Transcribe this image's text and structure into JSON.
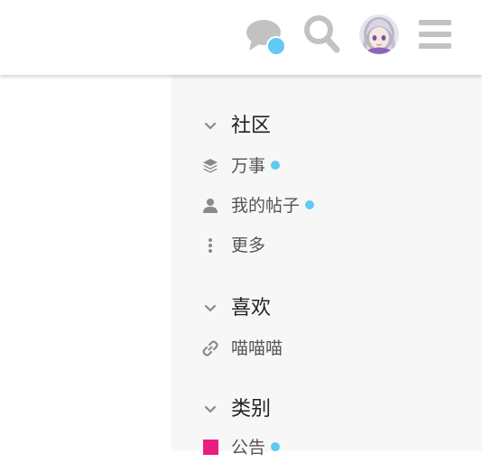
{
  "colors": {
    "accent_dot": "#62c8f5",
    "icon_gray": "#c2c2c2",
    "sidebar_icon": "#8a8a8a",
    "category_announcement": "#e91e80"
  },
  "header": {
    "chat_icon": "chat-bubbles-icon",
    "search_icon": "search-icon",
    "avatar_icon": "user-avatar",
    "menu_icon": "hamburger-menu-icon"
  },
  "sidebar": {
    "community": {
      "title": "社区",
      "items": [
        {
          "label": "万事",
          "icon": "layers-icon",
          "unread": true
        },
        {
          "label": "我的帖子",
          "icon": "user-icon",
          "unread": true
        },
        {
          "label": "更多",
          "icon": "vertical-ellipsis-icon",
          "unread": false
        }
      ]
    },
    "favorites": {
      "title": "喜欢",
      "items": [
        {
          "label": "喵喵喵",
          "icon": "link-icon",
          "unread": false
        }
      ]
    },
    "categories": {
      "title": "类别",
      "items": [
        {
          "label": "公告",
          "icon": "category-square",
          "unread": true
        }
      ]
    }
  }
}
